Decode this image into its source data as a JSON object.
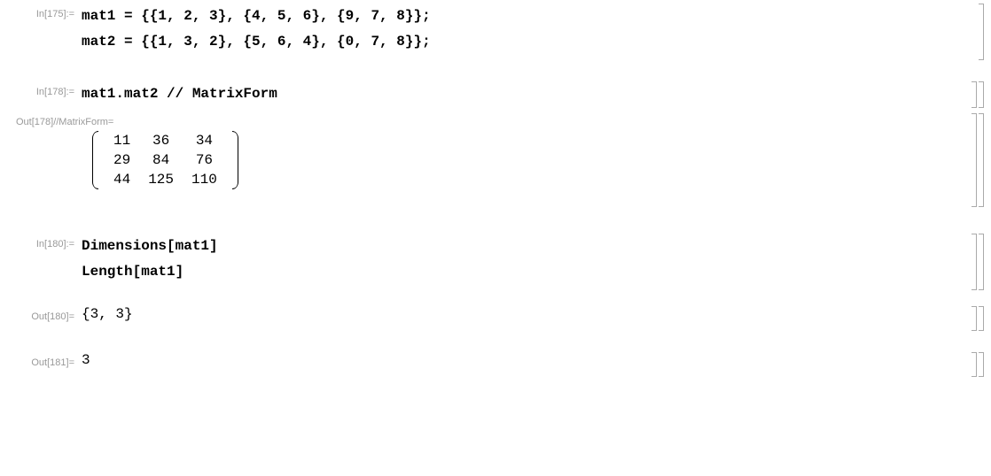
{
  "cells": {
    "c1": {
      "label": "In[175]:=",
      "line1": "mat1 = {{1, 2, 3}, {4, 5, 6}, {9, 7, 8}};",
      "line2": "mat2 = {{1, 3, 2}, {5, 6, 4}, {0, 7, 8}};"
    },
    "c2": {
      "label": "In[178]:=",
      "code": "mat1.mat2 // MatrixForm"
    },
    "c3": {
      "label": "Out[178]//MatrixForm=",
      "matrix": [
        [
          "11",
          "36",
          "34"
        ],
        [
          "29",
          "84",
          "76"
        ],
        [
          "44",
          "125",
          "110"
        ]
      ]
    },
    "c4": {
      "label": "In[180]:=",
      "line1": "Dimensions[mat1]",
      "line2": "Length[mat1]"
    },
    "c5": {
      "label": "Out[180]=",
      "value": "{3, 3}"
    },
    "c6": {
      "label": "Out[181]=",
      "value": "3"
    }
  }
}
